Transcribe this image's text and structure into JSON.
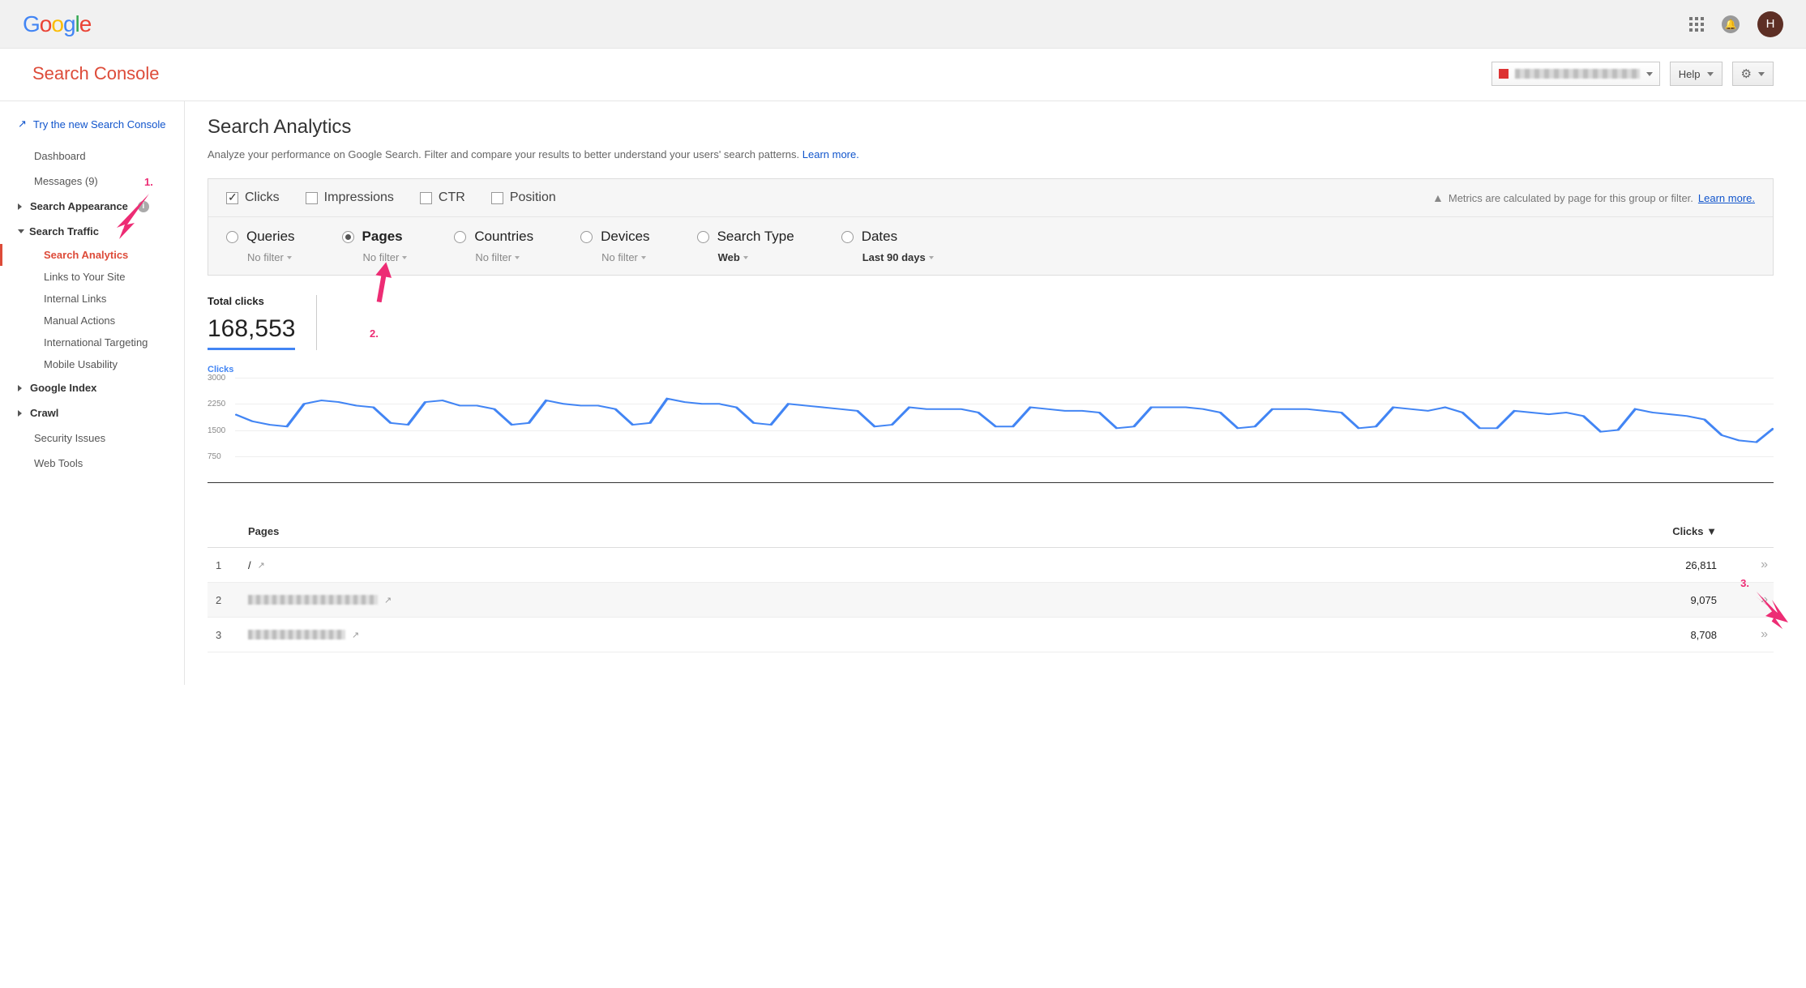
{
  "header": {
    "logo": "Google",
    "avatar_initial": "H"
  },
  "titlebar": {
    "product": "Search Console",
    "help_label": "Help"
  },
  "sidebar": {
    "try_new": "Try the new Search Console",
    "dashboard": "Dashboard",
    "messages": "Messages (9)",
    "search_appearance": "Search Appearance",
    "search_traffic": "Search Traffic",
    "sa": "Search Analytics",
    "links": "Links to Your Site",
    "internal": "Internal Links",
    "manual": "Manual Actions",
    "intl": "International Targeting",
    "mobile": "Mobile Usability",
    "gindex": "Google Index",
    "crawl": "Crawl",
    "security": "Security Issues",
    "webtools": "Web Tools"
  },
  "page": {
    "title": "Search Analytics",
    "subtitle_a": "Analyze your performance on Google Search. Filter and compare your results to better understand your users' search patterns. ",
    "subtitle_link": "Learn more."
  },
  "metrics": {
    "clicks": "Clicks",
    "impressions": "Impressions",
    "ctr": "CTR",
    "position": "Position",
    "warn": "Metrics are calculated by page for this group or filter.",
    "warn_link": "Learn more."
  },
  "dimensions": {
    "queries": "Queries",
    "pages": "Pages",
    "countries": "Countries",
    "devices": "Devices",
    "search_type": "Search Type",
    "dates": "Dates",
    "no_filter": "No filter",
    "web": "Web",
    "last90": "Last 90 days"
  },
  "total": {
    "label": "Total clicks",
    "value": "168,553"
  },
  "chart_data": {
    "type": "line",
    "title": "Clicks",
    "xlabel": "",
    "ylabel": "",
    "ylim": [
      0,
      3000
    ],
    "yticks": [
      750,
      1500,
      2250,
      3000
    ],
    "x": [
      0,
      1,
      2,
      3,
      4,
      5,
      6,
      7,
      8,
      9,
      10,
      11,
      12,
      13,
      14,
      15,
      16,
      17,
      18,
      19,
      20,
      21,
      22,
      23,
      24,
      25,
      26,
      27,
      28,
      29,
      30,
      31,
      32,
      33,
      34,
      35,
      36,
      37,
      38,
      39,
      40,
      41,
      42,
      43,
      44,
      45,
      46,
      47,
      48,
      49,
      50,
      51,
      52,
      53,
      54,
      55,
      56,
      57,
      58,
      59,
      60,
      61,
      62,
      63,
      64,
      65,
      66,
      67,
      68,
      69,
      70,
      71,
      72,
      73,
      74,
      75,
      76,
      77,
      78,
      79,
      80,
      81,
      82,
      83,
      84,
      85,
      86,
      87,
      88,
      89
    ],
    "values": [
      1950,
      1750,
      1650,
      1600,
      2250,
      2350,
      2300,
      2200,
      2150,
      1700,
      1650,
      2300,
      2350,
      2200,
      2200,
      2100,
      1650,
      1700,
      2350,
      2250,
      2200,
      2200,
      2100,
      1650,
      1700,
      2400,
      2300,
      2250,
      2250,
      2150,
      1700,
      1650,
      2250,
      2200,
      2150,
      2100,
      2050,
      1600,
      1650,
      2150,
      2100,
      2100,
      2100,
      2000,
      1600,
      1600,
      2150,
      2100,
      2050,
      2050,
      2000,
      1550,
      1600,
      2150,
      2150,
      2150,
      2100,
      2000,
      1550,
      1600,
      2100,
      2100,
      2100,
      2050,
      2000,
      1550,
      1600,
      2150,
      2100,
      2050,
      2150,
      2000,
      1550,
      1550,
      2050,
      2000,
      1950,
      2000,
      1900,
      1450,
      1500,
      2100,
      2000,
      1950,
      1900,
      1800,
      1350,
      1200,
      1150,
      1550
    ]
  },
  "table": {
    "col_pages": "Pages",
    "col_clicks": "Clicks",
    "rows": [
      {
        "n": "1",
        "page": "/",
        "clicks": "26,811",
        "blur": false
      },
      {
        "n": "2",
        "page": "",
        "clicks": "9,075",
        "blur": true,
        "blur_w": 160
      },
      {
        "n": "3",
        "page": "",
        "clicks": "8,708",
        "blur": true,
        "blur_w": 120
      }
    ]
  },
  "annotations": {
    "a1": "1.",
    "a2": "2.",
    "a3": "3."
  }
}
